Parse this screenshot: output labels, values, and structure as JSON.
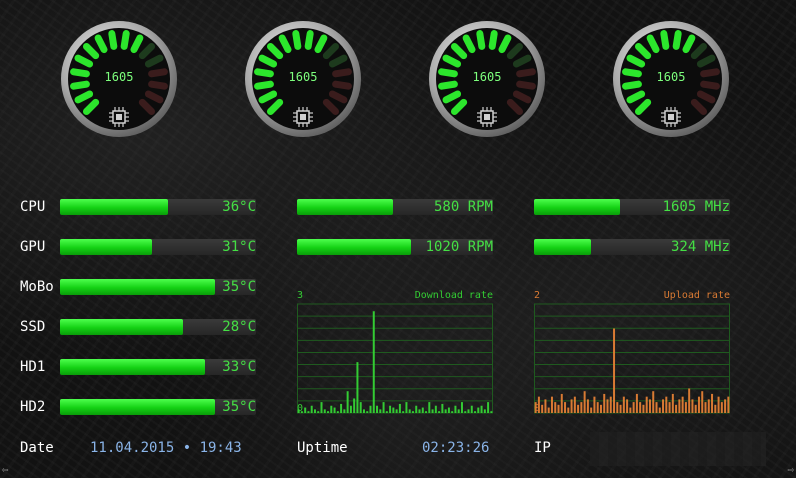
{
  "gauges": [
    {
      "value": "1605",
      "level": 0.62
    },
    {
      "value": "1605",
      "level": 0.62
    },
    {
      "value": "1605",
      "level": 0.62
    },
    {
      "value": "1605",
      "level": 0.62
    }
  ],
  "temps": [
    {
      "label": "CPU",
      "value": "36°C",
      "level": 0.55
    },
    {
      "label": "GPU",
      "value": "31°C",
      "level": 0.47
    },
    {
      "label": "MoBo",
      "value": "35°C",
      "level": 0.79
    },
    {
      "label": "SSD",
      "value": "28°C",
      "level": 0.63
    },
    {
      "label": "HD1",
      "value": "33°C",
      "level": 0.74
    },
    {
      "label": "HD2",
      "value": "35°C",
      "level": 0.79
    }
  ],
  "fans": [
    {
      "value": "580 RPM",
      "level": 0.49
    },
    {
      "value": "1020 RPM",
      "level": 0.58
    }
  ],
  "clocks": [
    {
      "value": "1605 MHz",
      "level": 0.44
    },
    {
      "value": "324 MHz",
      "level": 0.29
    }
  ],
  "download": {
    "title": "Download rate",
    "max_label": "3",
    "min_label": "0",
    "color": "#33cc33",
    "values": [
      0.1,
      0.05,
      0.15,
      0.05,
      0.2,
      0.1,
      0.05,
      0.3,
      0.1,
      0.05,
      0.2,
      0.15,
      0.05,
      0.25,
      0.1,
      0.6,
      0.2,
      0.4,
      1.4,
      0.3,
      0.1,
      0.05,
      0.2,
      2.8,
      0.2,
      0.1,
      0.3,
      0.05,
      0.2,
      0.15,
      0.1,
      0.25,
      0.05,
      0.3,
      0.1,
      0.05,
      0.2,
      0.1,
      0.15,
      0.05,
      0.3,
      0.1,
      0.2,
      0.05,
      0.25,
      0.1,
      0.15,
      0.05,
      0.2,
      0.1,
      0.3,
      0.05,
      0.1,
      0.2,
      0.05,
      0.15,
      0.2,
      0.1,
      0.3,
      0.05
    ]
  },
  "upload": {
    "title": "Upload rate",
    "max_label": "2",
    "min_label": "0",
    "color": "#d97a33",
    "values": [
      0.2,
      0.3,
      0.15,
      0.25,
      0.1,
      0.3,
      0.2,
      0.15,
      0.35,
      0.2,
      0.1,
      0.25,
      0.3,
      0.15,
      0.2,
      0.4,
      0.25,
      0.1,
      0.3,
      0.2,
      0.15,
      0.35,
      0.25,
      0.3,
      1.55,
      0.2,
      0.15,
      0.3,
      0.25,
      0.1,
      0.2,
      0.35,
      0.2,
      0.15,
      0.3,
      0.25,
      0.4,
      0.2,
      0.1,
      0.25,
      0.3,
      0.2,
      0.35,
      0.15,
      0.25,
      0.3,
      0.2,
      0.45,
      0.25,
      0.15,
      0.3,
      0.4,
      0.2,
      0.25,
      0.35,
      0.15,
      0.3,
      0.2,
      0.25,
      0.3
    ]
  },
  "footer": {
    "date_label": "Date",
    "date_value": "11.04.2015 • 19:43",
    "uptime_label": "Uptime",
    "uptime_value": "02:23:26",
    "ip_label": "IP"
  },
  "corners": {
    "left": "⇦",
    "right": "⇨"
  }
}
